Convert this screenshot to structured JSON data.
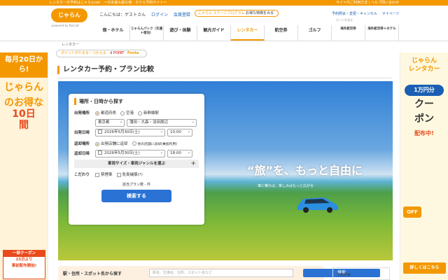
{
  "topbar": {
    "left": "レンタカーの予約はじゃらんnet　〜日本最大級の宿・ホテル予約サイト〜",
    "right": "サイト内ご利用方法 | ヘルプ問い合わせ"
  },
  "header": {
    "logo": "じゃらん",
    "logo_sub": "powered by Recruit",
    "greeting": "こんにちは：ゲストさん",
    "login": "ログイン",
    "register": "会員登録",
    "stage_brand": "じゃらん",
    "stage": "ステージプログラム",
    "stage_more": "お得な特典をみる",
    "links": [
      "予約照会・変更・キャンセル",
      "マイページ"
    ],
    "sub_link": "カートを見る"
  },
  "nav": {
    "items": [
      {
        "label": "宿・ホテル",
        "small": false
      },
      {
        "label": "じゃらんパック（交通＋宿泊）",
        "small": true
      },
      {
        "label": "遊び・体験",
        "small": false
      },
      {
        "label": "観光ガイド",
        "small": false
      },
      {
        "label": "レンタカー",
        "small": false,
        "active": true
      },
      {
        "label": "航空券",
        "small": false
      },
      {
        "label": "ゴルフ",
        "small": false
      },
      {
        "label": "海外航空券",
        "small": true
      },
      {
        "label": "海外航空券＋ホテル",
        "small": true
      }
    ]
  },
  "breadcrumb": "レンタカー",
  "points": {
    "text": "ポイントがたまる・つかえる",
    "dpoint": "d POINT",
    "ponta": "Ponta"
  },
  "page_title": "レンタカー予約・プラン比較",
  "hero": {
    "slogan": "“旅”を、もっと自由に",
    "sub": "車に乗れば、楽しみはもっと広がる"
  },
  "form": {
    "title": "場所・日時から探す",
    "depart_place_label": "出発場所",
    "place_options": [
      "都道府県",
      "空港",
      "新幹線駅"
    ],
    "pref": "東京都",
    "area": "蒲田・大森・羽田周辺",
    "depart_date_label": "出発日時",
    "depart_date": "2026年5月30日(土)",
    "depart_time": "10:00",
    "return_place_label": "返却場所",
    "return_options": [
      "出発店舗に返却",
      "他の店舗に返却(乗捨利用)"
    ],
    "return_date_label": "返却日時",
    "return_date": "2026年5月30日(土)",
    "return_time": "18:00",
    "genre": "車両サイズ・車両ジャンルを選ぶ",
    "pref_label": "こだわり",
    "checks": [
      "禁煙車",
      "免責補償(?)"
    ],
    "count": "該当プラン数 - 件",
    "search": "検索する"
  },
  "bottom_search": {
    "label": "駅・住所・スポット名から探す",
    "placeholder": "駅名、空港名、住所、スポット名など",
    "button": "検索"
  },
  "right_box": "予約照会",
  "left_ad": {
    "top": "毎月20日から!",
    "lines": [
      "じゃらん",
      "のお得な",
      "10日",
      "間"
    ],
    "foot_head": "一部クーポン",
    "foot_l1": "15日より",
    "foot_l2": "事前配布開始!"
  },
  "right_ad": {
    "brand": "じゃらん",
    "product": "レンタカー",
    "amount": "1万円分",
    "lines": [
      "クー",
      "ポン"
    ],
    "dist": "配布中!",
    "off": "OFF",
    "detail": "詳しくはこちら"
  }
}
